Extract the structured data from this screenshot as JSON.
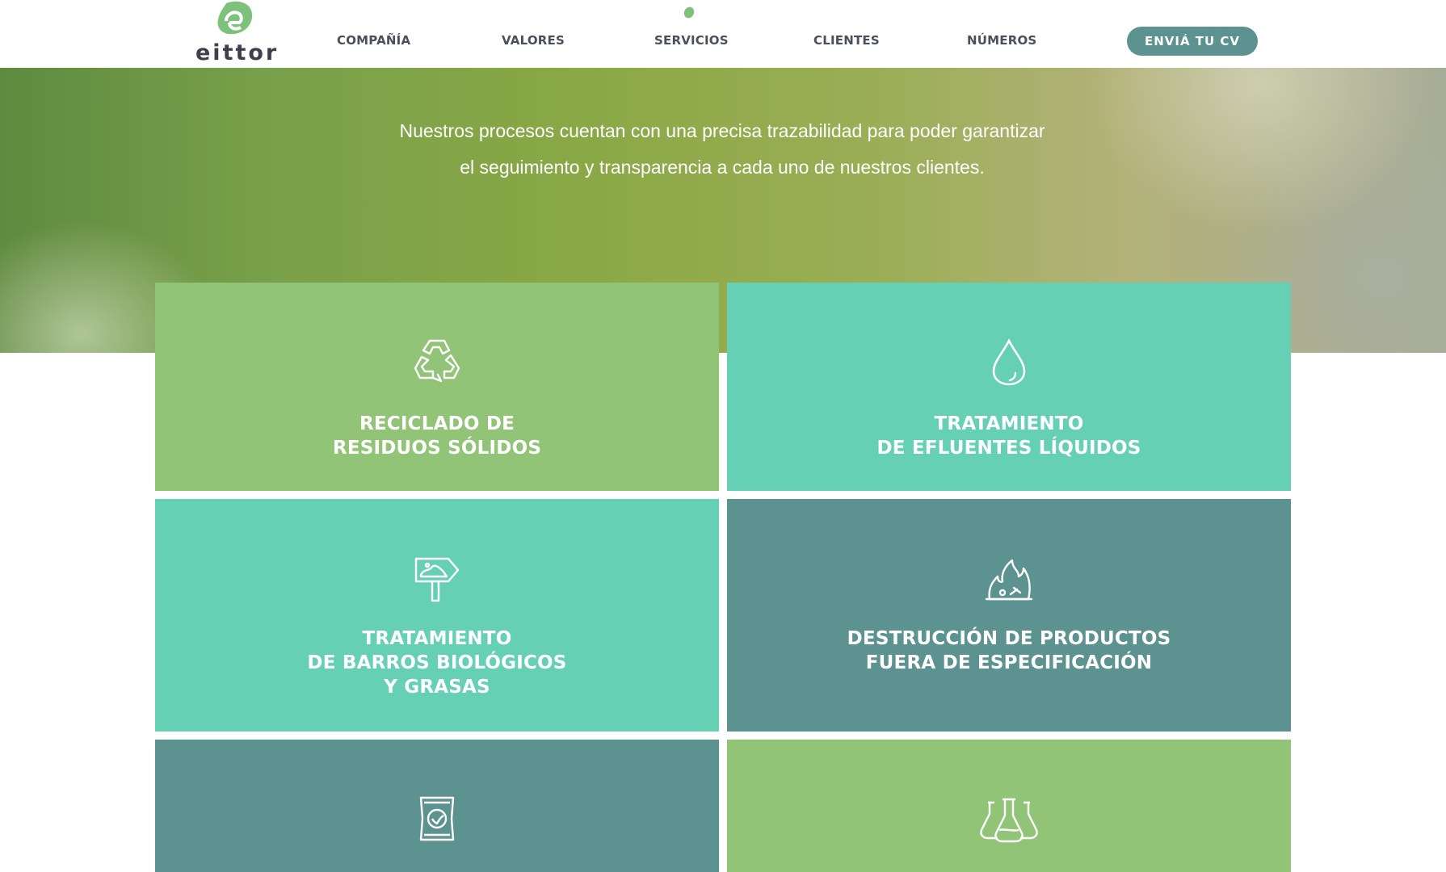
{
  "brand": {
    "name": "eittor"
  },
  "nav": {
    "items": [
      {
        "label": "COMPAÑÍA"
      },
      {
        "label": "VALORES"
      },
      {
        "label": "SERVICIOS"
      },
      {
        "label": "CLIENTES"
      },
      {
        "label": "NÚMEROS"
      }
    ],
    "active": "SERVICIOS",
    "cta_label": "ENVIÁ TU CV"
  },
  "hero": {
    "text": "Nuestros procesos cuentan con una precisa trazabilidad para poder garantizar el seguimiento y transparencia a cada uno de nuestros clientes."
  },
  "services": [
    {
      "title": "RECICLADO DE\nRESIDUOS SÓLIDOS",
      "icon": "recycle-icon",
      "color": "#91c477"
    },
    {
      "title": "TRATAMIENTO\nDE EFLUENTES LÍQUIDOS",
      "icon": "water-drop-icon",
      "color": "#66d0b4"
    },
    {
      "title": "TRATAMIENTO\nDE BARROS BIOLÓGICOS\nY GRASAS",
      "icon": "sludge-sign-icon",
      "color": "#66d0b4"
    },
    {
      "title": "DESTRUCCIÓN DE PRODUCTOS\nFUERA DE ESPECIFICACIÓN",
      "icon": "fire-destruction-icon",
      "color": "#5c9290"
    },
    {
      "title": "",
      "icon": "fertilizer-bag-icon",
      "color": "#5c9290"
    },
    {
      "title": "",
      "icon": "lab-flasks-icon",
      "color": "#91c477"
    }
  ],
  "colors": {
    "accent": "#5c9290",
    "green": "#91c477",
    "teal": "#66d0b4",
    "nav_text": "#4a4f5c"
  }
}
